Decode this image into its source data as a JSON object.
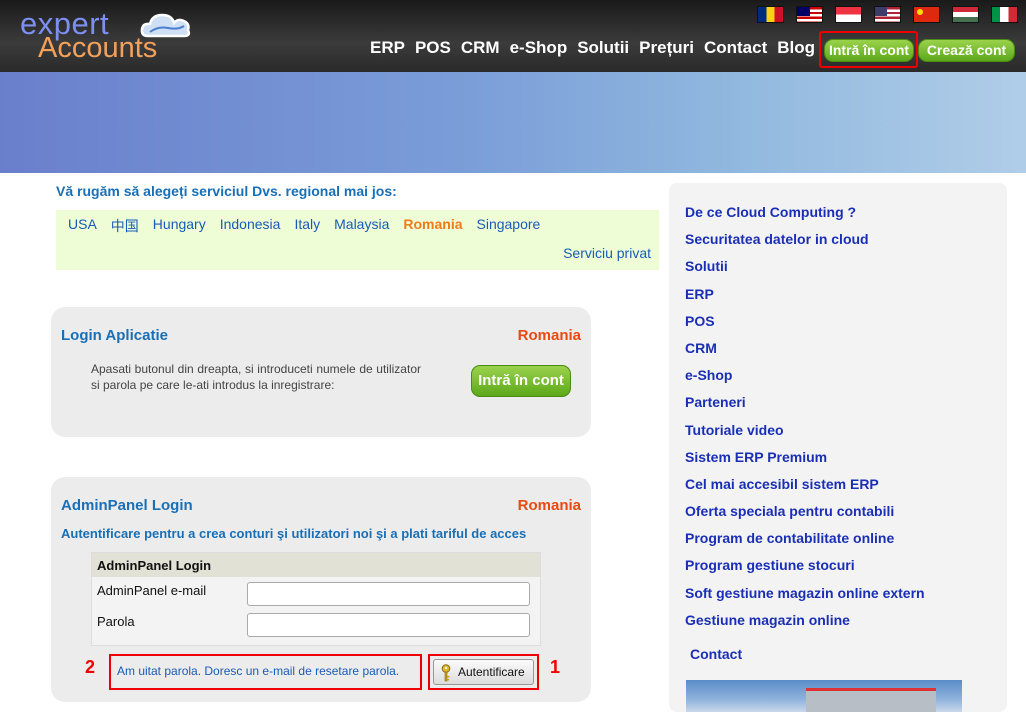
{
  "logo": {
    "line1": "expert",
    "line2": "Accounts"
  },
  "flags": [
    {
      "name": "romania-flag-icon",
      "colors": [
        "#002b7f",
        "#fcd116",
        "#ce1126"
      ]
    },
    {
      "name": "malaysia-flag-icon",
      "colors": [
        "#cc0001",
        "#ffffff",
        "#010066"
      ]
    },
    {
      "name": "singapore-flag-icon",
      "colors": [
        "#ef3340",
        "#ffffff"
      ]
    },
    {
      "name": "usa-flag-icon",
      "colors": [
        "#b22234",
        "#ffffff",
        "#3c3b6e"
      ]
    },
    {
      "name": "china-flag-icon",
      "colors": [
        "#de2910",
        "#ffde00"
      ]
    },
    {
      "name": "hungary-flag-icon",
      "colors": [
        "#ce2939",
        "#ffffff",
        "#477050"
      ]
    },
    {
      "name": "italy-flag-icon",
      "colors": [
        "#009246",
        "#ffffff",
        "#ce2b37"
      ]
    }
  ],
  "nav": {
    "items": [
      "ERP",
      "POS",
      "CRM",
      "e-Shop",
      "Solutii",
      "Prețuri",
      "Contact",
      "Blog"
    ],
    "login_label": "Intră în cont",
    "create_label": "Crează cont"
  },
  "region": {
    "title": "Vă rugăm să alegeți serviciul Dvs. regional mai jos:",
    "links": [
      "USA",
      "中国",
      "Hungary",
      "Indonesia",
      "Italy",
      "Malaysia",
      "Romania",
      "Singapore"
    ],
    "active": "Romania",
    "private_service": "Serviciu privat"
  },
  "app_login": {
    "title": "Login Aplicatie",
    "region": "Romania",
    "description": "Apasati butonul din dreapta, si introduceti numele de utilizator si parola pe care le-ati introdus la inregistrare:",
    "button": "Intră în cont"
  },
  "admin_login": {
    "title": "AdminPanel Login",
    "region": "Romania",
    "subtitle": "Autentificare pentru a crea conturi şi utilizatori noi şi a plati tariful de acces",
    "form_header": "AdminPanel Login",
    "email_label": "AdminPanel e-mail",
    "password_label": "Parola",
    "forgot_link": "Am uitat parola. Doresc un e-mail de resetare parola.",
    "auth_button": "Autentificare",
    "annotation_1": "1",
    "annotation_2": "2"
  },
  "sidebar": {
    "links": [
      "De ce Cloud Computing ?",
      "Securitatea datelor in cloud",
      "Solutii",
      "ERP",
      "POS",
      "CRM",
      "e-Shop",
      "Parteneri",
      "Tutoriale video",
      "Sistem ERP Premium",
      "Cel mai accesibil sistem ERP",
      "Oferta speciala pentru contabili",
      "Program de contabilitate online",
      "Program gestiune stocuri",
      "Soft gestiune magazin online extern",
      "Gestiune magazin online"
    ],
    "contact": "Contact"
  }
}
